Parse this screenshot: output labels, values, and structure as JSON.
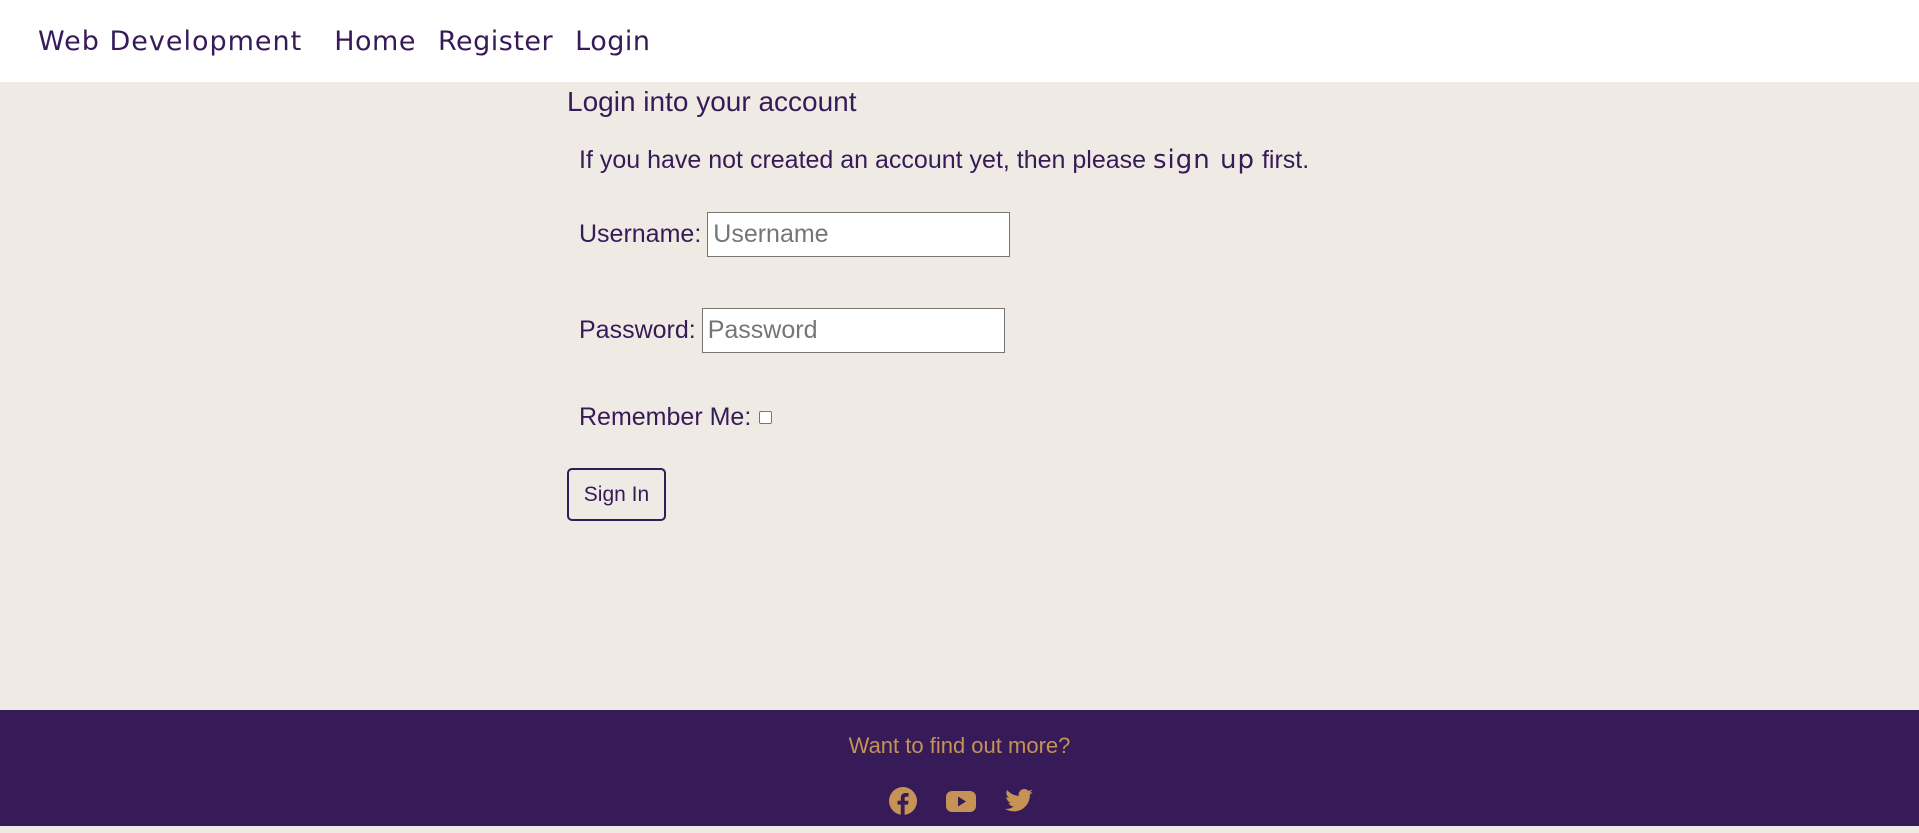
{
  "navbar": {
    "brand": "Web Development",
    "links": [
      "Home",
      "Register",
      "Login"
    ]
  },
  "main": {
    "title": "Login into your account",
    "intro_before": "If you have not created an account yet, then please ",
    "intro_link": "sign up",
    "intro_after": " first.",
    "username_label": "Username:",
    "username_placeholder": "Username",
    "username_value": "",
    "password_label": "Password:",
    "password_placeholder": "Password",
    "password_value": "",
    "remember_label": "Remember Me:",
    "remember_checked": false,
    "signin_label": "Sign In"
  },
  "footer": {
    "text": "Want to find out more?",
    "social_icons": [
      "facebook-icon",
      "youtube-icon",
      "twitter-icon"
    ]
  },
  "colors": {
    "primary": "#371a58",
    "accent": "#c49355",
    "background": "#efeae3",
    "navbar_bg": "#ffffff"
  }
}
